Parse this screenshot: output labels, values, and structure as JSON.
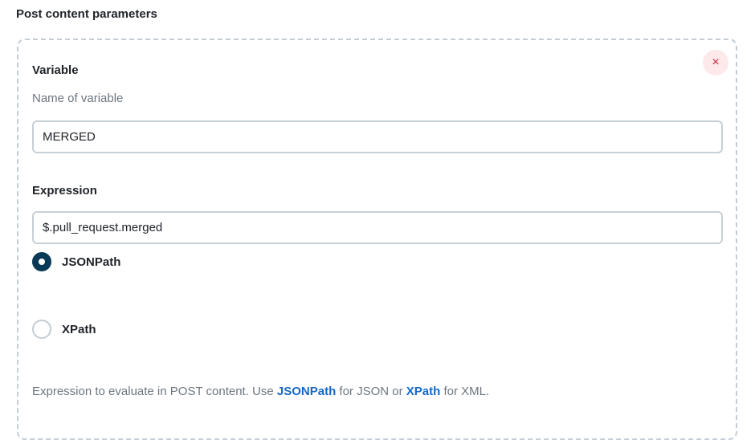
{
  "section": {
    "title": "Post content parameters"
  },
  "card": {
    "close_label": "×",
    "variable": {
      "label": "Variable",
      "help": "Name of variable",
      "value": "MERGED"
    },
    "expression": {
      "label": "Expression",
      "value": "$.pull_request.merged",
      "options": [
        {
          "label": "JSONPath",
          "selected": true
        },
        {
          "label": "XPath",
          "selected": false
        }
      ],
      "help_prefix": "Expression to evaluate in POST content. Use ",
      "help_link1": "JSONPath",
      "help_mid": " for JSON or ",
      "help_link2": "XPath",
      "help_suffix": " for XML."
    }
  },
  "colors": {
    "accent": "#0b3a57",
    "link": "#1668c7",
    "danger": "#d1263a"
  }
}
